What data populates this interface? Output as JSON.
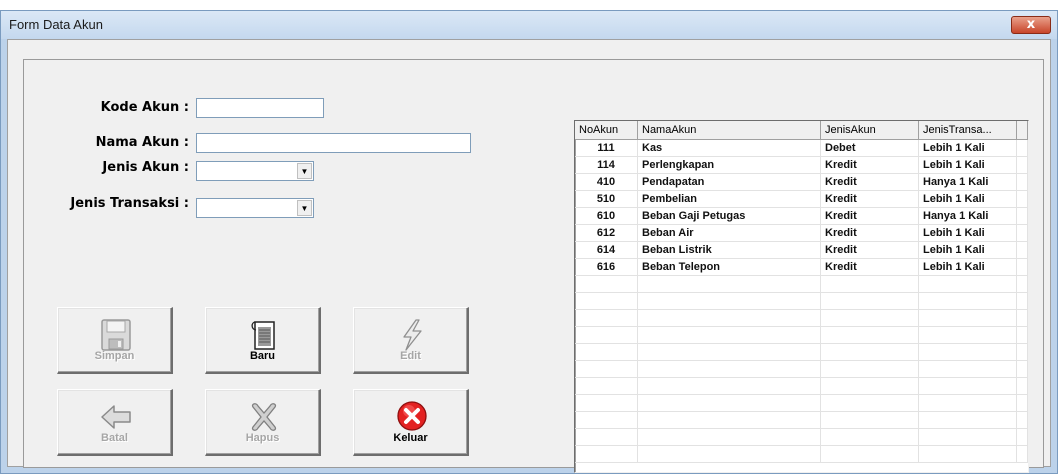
{
  "window": {
    "title": "Form Data Akun",
    "close_glyph": "x"
  },
  "form": {
    "kode_akun": {
      "label": "Kode Akun :",
      "value": ""
    },
    "nama_akun": {
      "label": "Nama Akun :",
      "value": ""
    },
    "jenis_akun": {
      "label": "Jenis Akun :",
      "value": ""
    },
    "jenis_transaksi": {
      "label": "Jenis Transaksi :",
      "value": ""
    }
  },
  "buttons": {
    "simpan": {
      "label": "Simpan",
      "icon": "floppy-disk-icon",
      "enabled": false
    },
    "baru": {
      "label": "Baru",
      "icon": "new-document-icon",
      "enabled": true
    },
    "edit": {
      "label": "Edit",
      "icon": "lightning-icon",
      "enabled": false
    },
    "batal": {
      "label": "Batal",
      "icon": "arrow-left-icon",
      "enabled": false
    },
    "hapus": {
      "label": "Hapus",
      "icon": "delete-x-icon",
      "enabled": false
    },
    "keluar": {
      "label": "Keluar",
      "icon": "red-close-icon",
      "enabled": true
    }
  },
  "grid": {
    "columns": [
      "NoAkun",
      "NamaAkun",
      "JenisAkun",
      "JenisTransa..."
    ],
    "rows": [
      [
        "111",
        "Kas",
        "Debet",
        "Lebih 1 Kali"
      ],
      [
        "114",
        "Perlengkapan",
        "Kredit",
        "Lebih 1 Kali"
      ],
      [
        "410",
        "Pendapatan",
        "Kredit",
        "Hanya 1 Kali"
      ],
      [
        "510",
        "Pembelian",
        "Kredit",
        "Lebih 1 Kali"
      ],
      [
        "610",
        "Beban Gaji Petugas",
        "Kredit",
        "Hanya 1 Kali"
      ],
      [
        "612",
        "Beban Air",
        "Kredit",
        "Lebih 1 Kali"
      ],
      [
        "614",
        "Beban Listrik",
        "Kredit",
        "Lebih 1 Kali"
      ],
      [
        "616",
        "Beban Telepon",
        "Kredit",
        "Lebih 1 Kali"
      ]
    ]
  },
  "colors": {
    "title_bg": "#c4d8ee",
    "close_red": "#c8452a",
    "keluar_red": "#e32222"
  }
}
